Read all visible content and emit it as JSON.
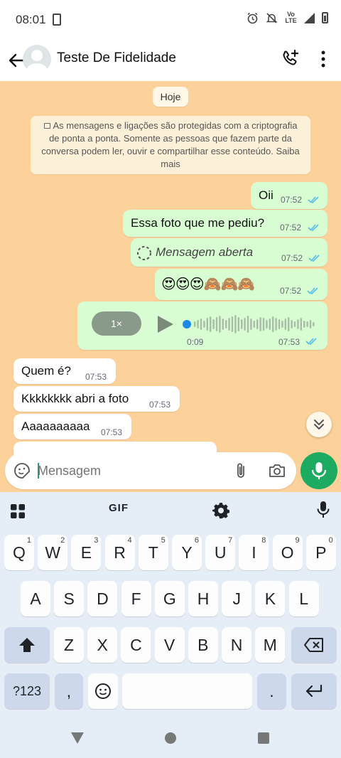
{
  "status_bar": {
    "time": "08:01",
    "volte_label": "Vo¹\nLTE"
  },
  "header": {
    "contact_name": "Teste De Fidelidade"
  },
  "chat": {
    "date_chip": "Hoje",
    "encryption_notice": "As mensagens e ligações são protegidas com a criptografia de ponta a ponta. Somente as pessoas que fazem parte da conversa podem ler, ouvir e compartilhar esse conteúdo. Saiba mais",
    "messages": [
      {
        "direction": "out",
        "text": "Oii",
        "time": "07:52"
      },
      {
        "direction": "out",
        "text": "Essa foto que me pediu?",
        "time": "07:52"
      },
      {
        "direction": "out",
        "text": "Mensagem aberta",
        "time": "07:52"
      },
      {
        "direction": "out",
        "text": "😍😍😍🙈🙈🙈",
        "time": "07:52"
      },
      {
        "direction": "out",
        "type": "voice",
        "speed": "1×",
        "duration": "0:09",
        "time": "07:53",
        "progress": 0
      },
      {
        "direction": "in",
        "text": "Quem é?",
        "time": "07:53"
      },
      {
        "direction": "in",
        "text": "Kkkkkkkk abri a foto",
        "time": "07:53"
      },
      {
        "direction": "in",
        "text": "Aaaaaaaaaa",
        "time": "07:53"
      }
    ]
  },
  "composer": {
    "placeholder": "Mensagem"
  },
  "keyboard": {
    "gif_label": "GIF",
    "row1": [
      {
        "k": "Q",
        "h": "1"
      },
      {
        "k": "W",
        "h": "2"
      },
      {
        "k": "E",
        "h": "3"
      },
      {
        "k": "R",
        "h": "4"
      },
      {
        "k": "T",
        "h": "5"
      },
      {
        "k": "Y",
        "h": "6"
      },
      {
        "k": "U",
        "h": "7"
      },
      {
        "k": "I",
        "h": "8"
      },
      {
        "k": "O",
        "h": "9"
      },
      {
        "k": "P",
        "h": "0"
      }
    ],
    "row2": [
      "A",
      "S",
      "D",
      "F",
      "G",
      "H",
      "J",
      "K",
      "L"
    ],
    "row3": [
      "Z",
      "X",
      "C",
      "V",
      "B",
      "N",
      "M"
    ],
    "symbols_label": "?123",
    "comma": ",",
    "period": "."
  },
  "colors": {
    "chat_background": "#fdd29a",
    "outgoing_bubble": "#d9fdd3",
    "incoming_bubble": "#ffffff",
    "read_ticks": "#53bdeb",
    "mic_button": "#1daa61",
    "keyboard_background": "#e5edf7"
  }
}
